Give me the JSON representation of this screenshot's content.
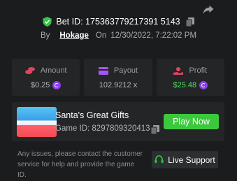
{
  "header": {
    "bet_id": "Bet ID: 175363779217391 5143",
    "by_label": "By",
    "username": "Hokage",
    "on_label": "On",
    "datetime": "12/30/2022, 7:22:02 PM"
  },
  "stats": [
    {
      "label": "Amount",
      "value": "$0.25",
      "icon": "coins-icon",
      "color": "#e0455c"
    },
    {
      "label": "Payout",
      "value": "102.9212 x",
      "icon": "card-icon",
      "color": "#a855f7"
    },
    {
      "label": "Profit",
      "value": "$25.48",
      "icon": "hand-coin-icon",
      "color": "#e0455c"
    }
  ],
  "game": {
    "title": "Santa's Great Gifts",
    "game_id": "Game ID: 8297809320413",
    "play_label": "Play Now"
  },
  "support": {
    "text": "Any issues, please contact the customer service for help and provide the game ID.",
    "button_label": "Live Support"
  },
  "colors": {
    "accent_green": "#3cc83c",
    "profit_green": "#4fe05f",
    "coin_purple": "#8a3fe8",
    "panel": "#232527",
    "background": "#1a1c1d"
  }
}
